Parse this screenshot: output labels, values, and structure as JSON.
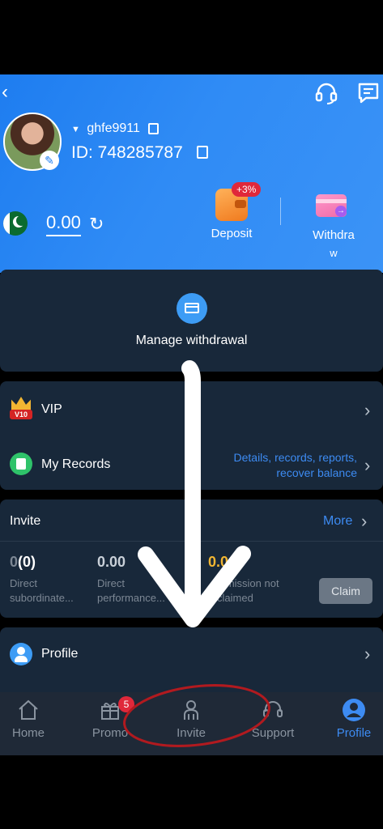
{
  "header": {
    "username": "ghfe9911",
    "user_id": "ID: 748285787",
    "balance": "0.00",
    "deposit_label": "Deposit",
    "deposit_badge": "+3%",
    "withdraw_label_line1": "Withdra",
    "withdraw_label_line2": "w"
  },
  "manage": {
    "label": "Manage withdrawal"
  },
  "menu": {
    "vip_label": "VIP",
    "vip_badge": "V10",
    "records_label": "My Records",
    "records_desc_line1": "Details, records, reports,",
    "records_desc_line2": "recover balance"
  },
  "invite": {
    "title": "Invite",
    "more_label": "More",
    "stat1_value_prefix": "0",
    "stat1_value_suffix": "(0)",
    "stat1_label_line1": "Direct",
    "stat1_label_line2": "subordinate...",
    "stat2_value": "0.00",
    "stat2_label_line1": "Direct",
    "stat2_label_line2": "performance...",
    "stat3_value": "0.0",
    "stat3_label_line1": "mmission not",
    "stat3_label_line2": "claimed",
    "claim_label": "Claim"
  },
  "profile_row": {
    "label": "Profile"
  },
  "nav": {
    "home": "Home",
    "promo": "Promo",
    "promo_badge": "5",
    "invite": "Invite",
    "support": "Support",
    "profile": "Profile"
  },
  "colors": {
    "header_blue": "#2f8bf5",
    "accent_blue": "#3d8bf2",
    "card_bg": "#18283a",
    "nav_bg": "#1f2937",
    "badge_red": "#e0283a",
    "gold": "#f2b632",
    "annotation_red": "#b11a1f"
  }
}
